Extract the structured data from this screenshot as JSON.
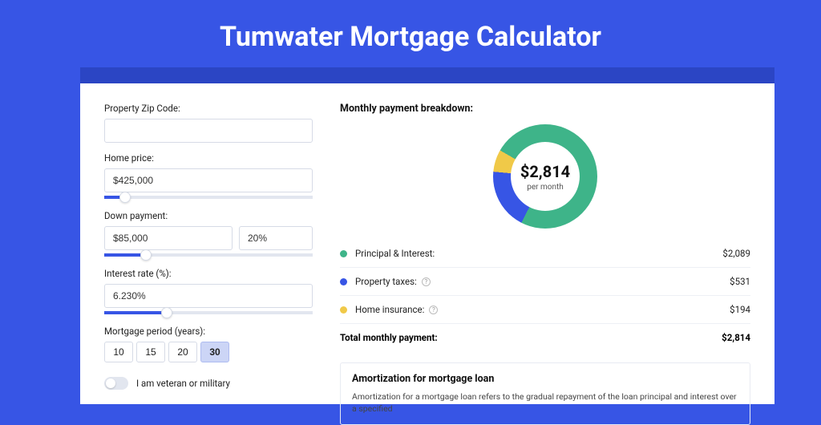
{
  "title": "Tumwater Mortgage Calculator",
  "form": {
    "zip": {
      "label": "Property Zip Code:",
      "value": ""
    },
    "home_price": {
      "label": "Home price:",
      "value": "$425,000",
      "slider_pct": 10
    },
    "down_payment": {
      "label": "Down payment:",
      "amount": "$85,000",
      "pct": "20%",
      "slider_pct": 20
    },
    "interest": {
      "label": "Interest rate (%):",
      "value": "6.230%",
      "slider_pct": 30
    },
    "period": {
      "label": "Mortgage period (years):",
      "options": [
        "10",
        "15",
        "20",
        "30"
      ],
      "selected": "30"
    },
    "veteran": {
      "label": "I am veteran or military",
      "checked": false
    }
  },
  "breakdown": {
    "heading": "Monthly payment breakdown:",
    "center_amount": "$2,814",
    "center_sub": "per month",
    "items": [
      {
        "label": "Principal & Interest:",
        "amount": "$2,089",
        "color": "#3EB489",
        "info": false
      },
      {
        "label": "Property taxes:",
        "amount": "$531",
        "color": "#3755E5",
        "info": true
      },
      {
        "label": "Home insurance:",
        "amount": "$194",
        "color": "#F0C948",
        "info": true
      }
    ],
    "total_label": "Total monthly payment:",
    "total_amount": "$2,814"
  },
  "chart_data": {
    "type": "pie",
    "title": "Monthly payment breakdown",
    "series": [
      {
        "name": "Principal & Interest",
        "value": 2089,
        "color": "#3EB489"
      },
      {
        "name": "Property taxes",
        "value": 531,
        "color": "#3755E5"
      },
      {
        "name": "Home insurance",
        "value": 194,
        "color": "#F0C948"
      }
    ],
    "total": 2814,
    "unit": "USD per month"
  },
  "amortization": {
    "heading": "Amortization for mortgage loan",
    "body": "Amortization for a mortgage loan refers to the gradual repayment of the loan principal and interest over a specified"
  }
}
